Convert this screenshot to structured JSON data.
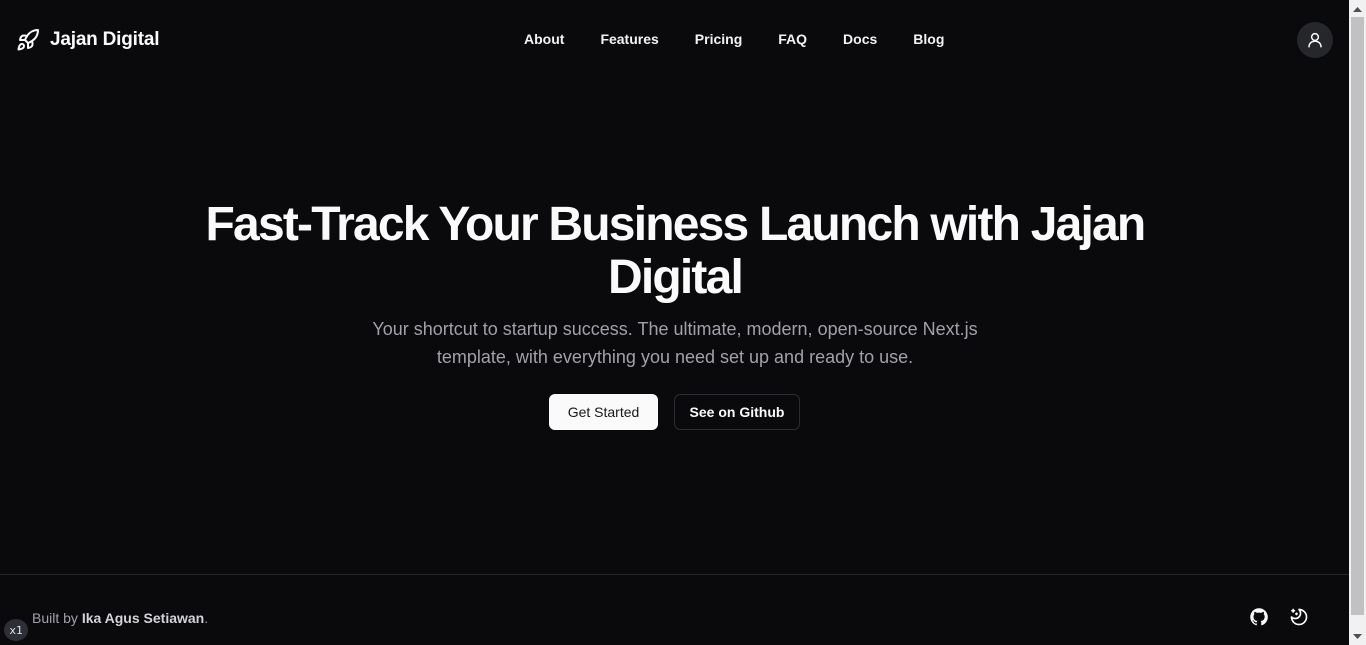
{
  "brand": {
    "name": "Jajan Digital",
    "icon": "rocket-icon"
  },
  "nav": {
    "items": [
      {
        "label": "About"
      },
      {
        "label": "Features"
      },
      {
        "label": "Pricing"
      },
      {
        "label": "FAQ"
      },
      {
        "label": "Docs"
      },
      {
        "label": "Blog"
      }
    ]
  },
  "header": {
    "user_icon": "user-icon"
  },
  "hero": {
    "title": "Fast-Track Your Business Launch with Jajan Digital",
    "subtitle": "Your shortcut to startup success. The ultimate, modern, open-source Next.js template, with everything you need set up and ready to use.",
    "primary_cta": "Get Started",
    "secondary_cta": "See on Github"
  },
  "footer": {
    "built_prefix": "Built by ",
    "author": "Ika Agus Setiawan",
    "built_suffix": ".",
    "zoom_badge": "x1",
    "icons": [
      "github-icon",
      "theme-toggle-icon"
    ]
  },
  "colors": {
    "background": "#0a0a0c",
    "text": "#fafafa",
    "muted": "#a1a1aa",
    "border": "#27272a"
  }
}
